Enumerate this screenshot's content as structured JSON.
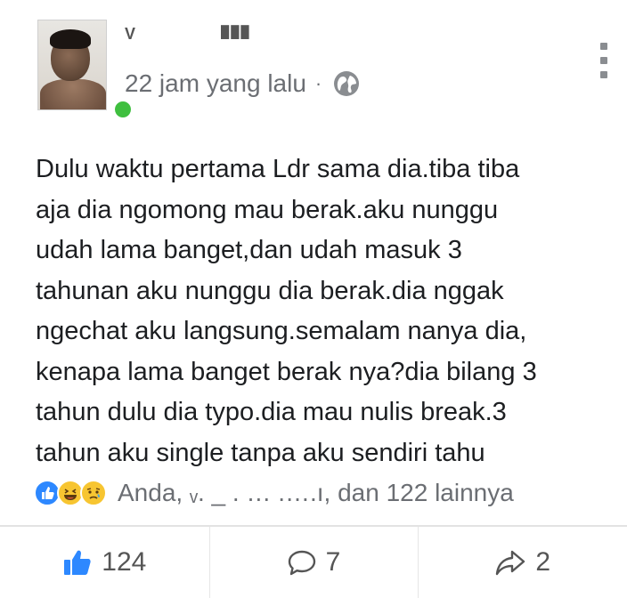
{
  "post": {
    "author_name": "V",
    "author_name_extra": "███",
    "timestamp": "22 jam yang lalu",
    "separator": "·",
    "privacy_icon": "globe-icon",
    "menu_icon": "vertical-dots-icon",
    "text_lines": [
      "Dulu waktu pertama Ldr sama dia.tiba tiba",
      "aja dia ngomong mau berak.aku nunggu",
      "udah lama banget,dan udah masuk 3",
      "tahunan aku nunggu dia berak.dia nggak",
      "ngechat aku langsung.semalam nanya dia,",
      "kenapa lama banget berak nya?dia bilang 3",
      "tahun dulu dia typo.dia mau nulis break.3",
      "tahun aku single tanpa aku sendiri tahu"
    ]
  },
  "reactions": {
    "icons": [
      "like-reaction-icon",
      "haha-reaction-icon",
      "sad-reaction-icon"
    ],
    "summary": "Anda, ᵥ. _ . … .….ı, dan 122 lainnya"
  },
  "actions": {
    "like_count": "124",
    "comment_count": "7",
    "share_count": "2"
  },
  "colors": {
    "like_blue": "#2d88ff",
    "online_green": "#3fbf3f",
    "muted_text": "#6b6e73"
  }
}
